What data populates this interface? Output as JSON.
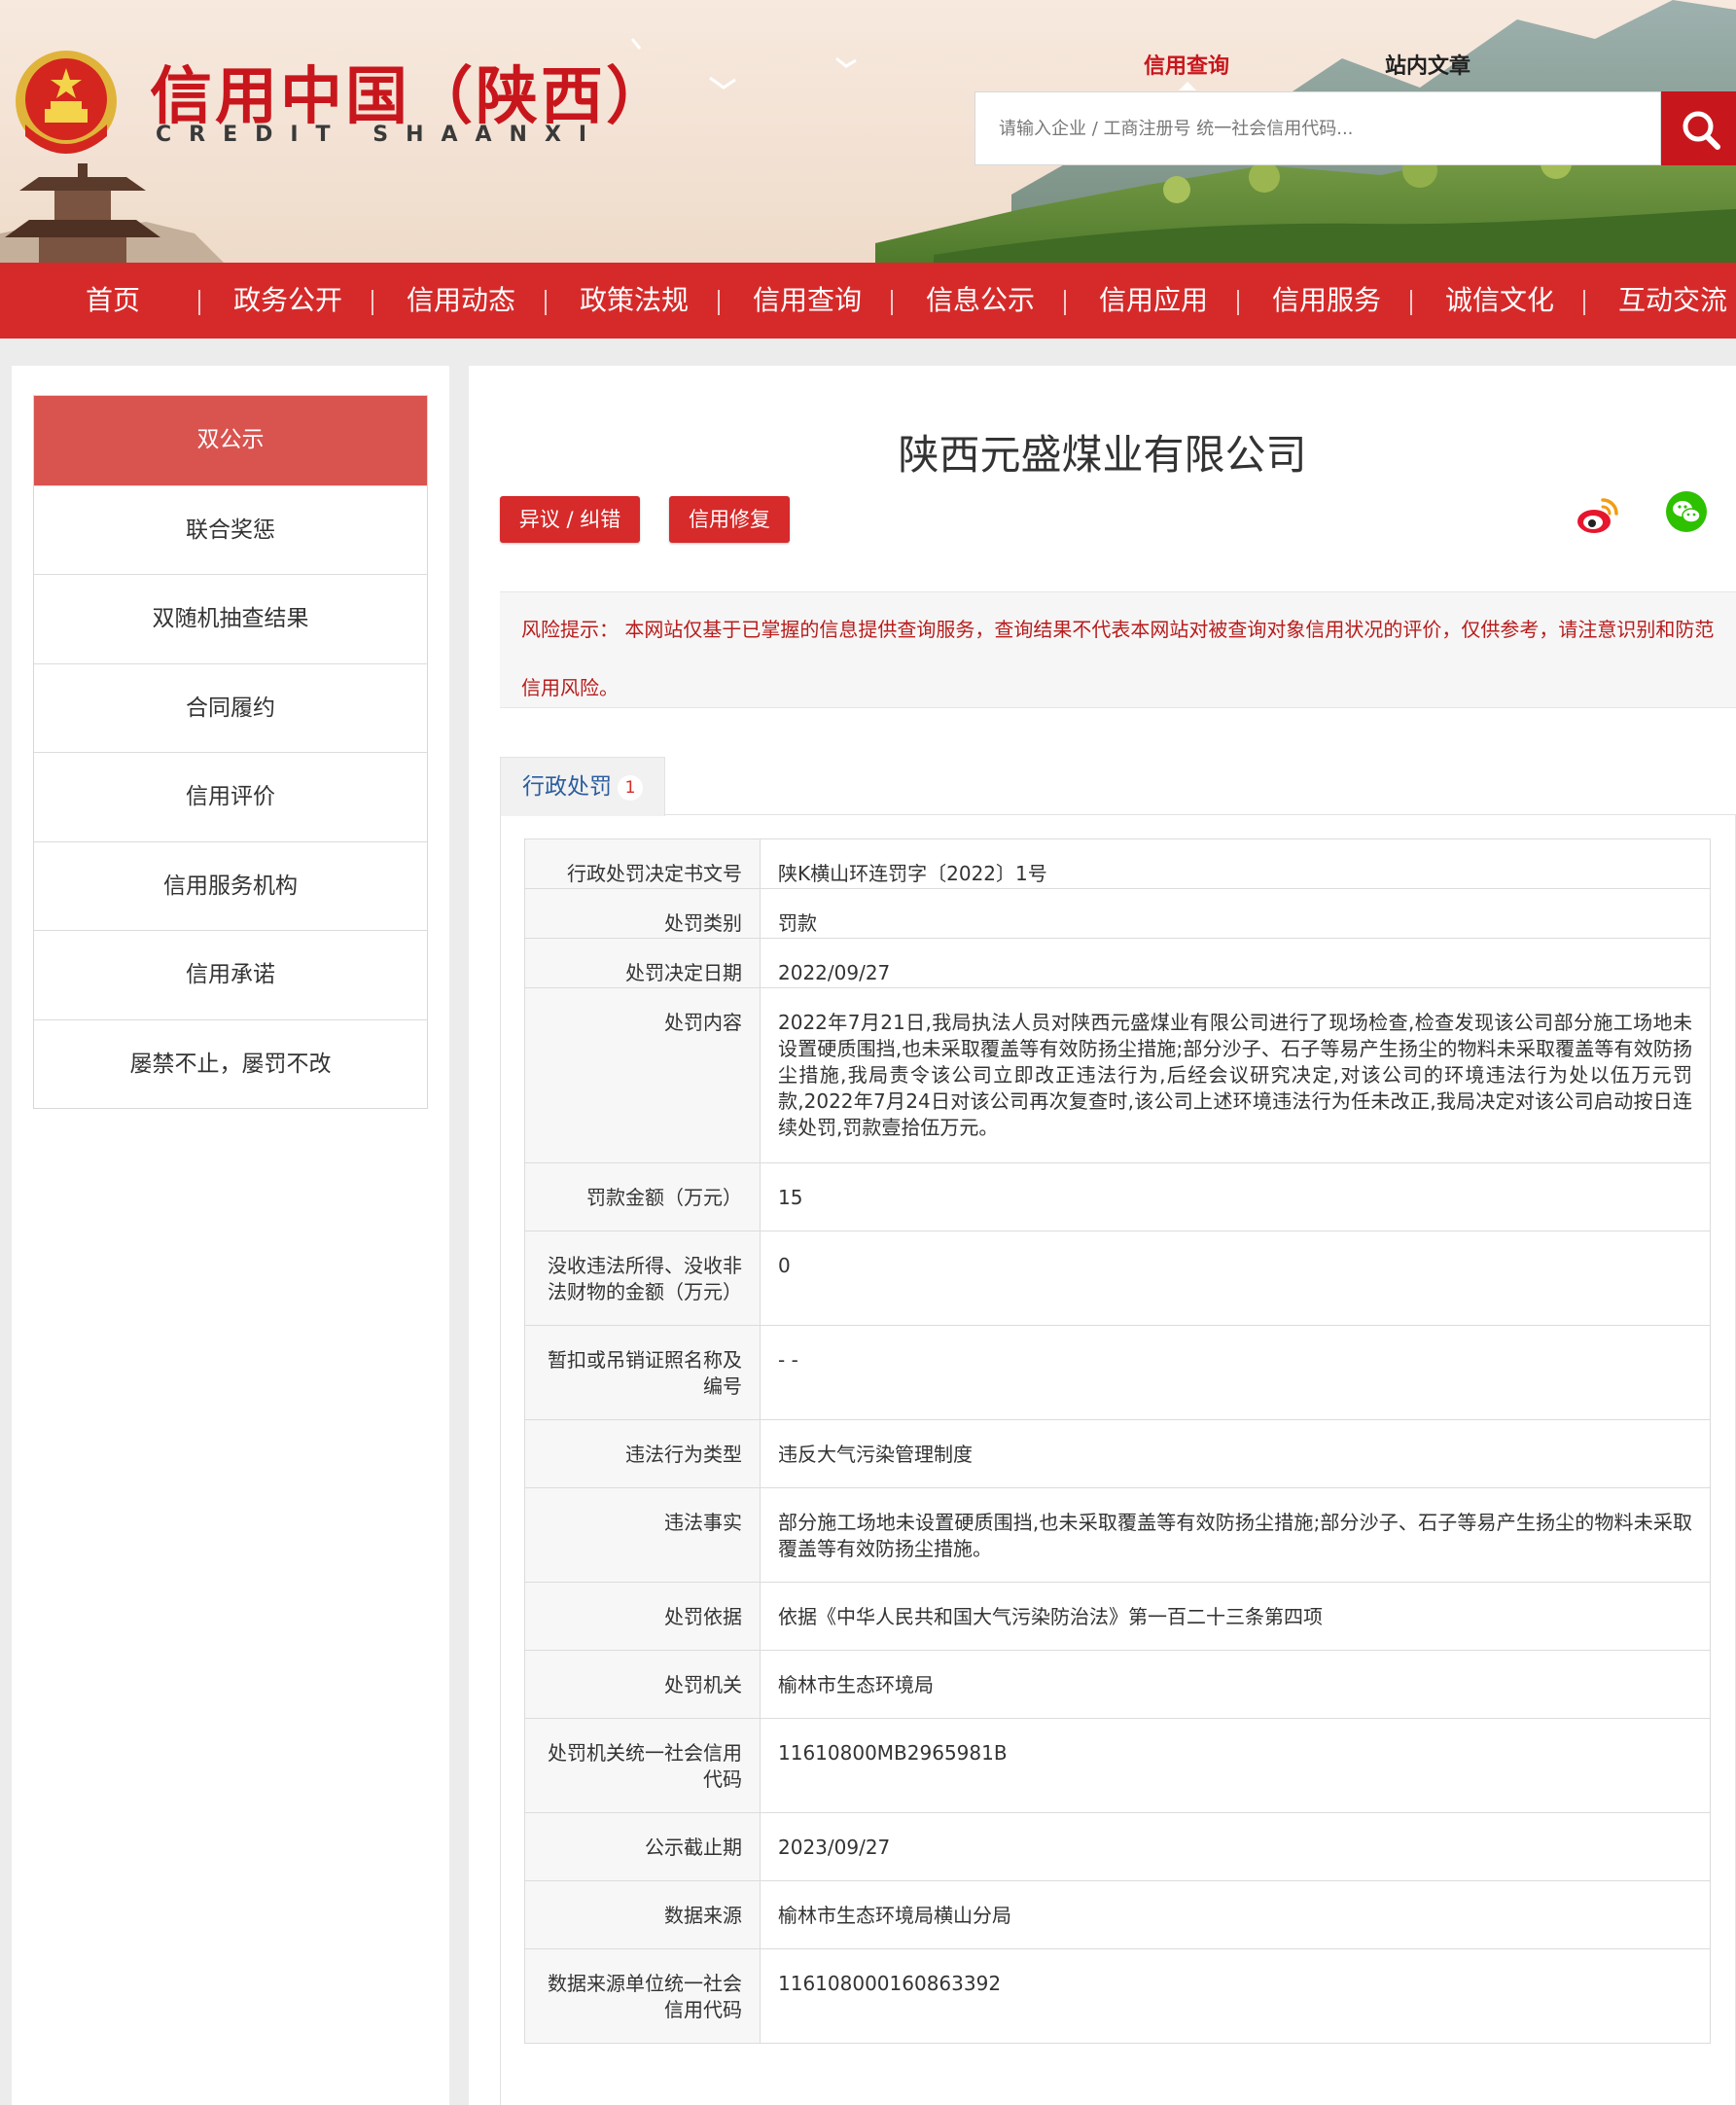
{
  "header": {
    "site_title": "信用中国（陕西）",
    "site_subtitle": "CREDIT   SHAANXI",
    "search_tabs": [
      {
        "label": "信用查询",
        "active": true
      },
      {
        "label": "站内文章",
        "active": false
      }
    ],
    "search_placeholder": "请输入企业 / 工商注册号 统一社会信用代码..."
  },
  "nav": {
    "items": [
      "首页",
      "政务公开",
      "信用动态",
      "政策法规",
      "信用查询",
      "信息公示",
      "信用应用",
      "信用服务",
      "诚信文化",
      "互动交流"
    ]
  },
  "sidebar": {
    "items": [
      {
        "label": "双公示",
        "active": true
      },
      {
        "label": "联合奖惩",
        "active": false
      },
      {
        "label": "双随机抽查结果",
        "active": false
      },
      {
        "label": "合同履约",
        "active": false
      },
      {
        "label": "信用评价",
        "active": false
      },
      {
        "label": "信用服务机构",
        "active": false
      },
      {
        "label": "信用承诺",
        "active": false
      },
      {
        "label": "屡禁不止，屡罚不改",
        "active": false
      }
    ]
  },
  "main": {
    "company_name": "陕西元盛煤业有限公司",
    "buttons": {
      "dispute": "异议 / 纠错",
      "repair": "信用修复"
    },
    "share_icons": [
      "weibo-icon",
      "wechat-icon"
    ],
    "risk_notice": "风险提示： 本网站仅基于已掌握的信息提供查询服务，查询结果不代表本网站对被查询对象信用状况的评价，仅供参考，请注意识别和防范信用风险。",
    "tab": {
      "label": "行政处罚",
      "count": "1"
    },
    "rows": [
      {
        "key": "行政处罚决定书文号",
        "value": "陕K横山环连罚字〔2022〕1号"
      },
      {
        "key": "处罚类别",
        "value": "罚款"
      },
      {
        "key": "处罚决定日期",
        "value": "2022/09/27"
      },
      {
        "key": "处罚内容",
        "value": "2022年7月21日,我局执法人员对陕西元盛煤业有限公司进行了现场检查,检查发现该公司部分施工场地未设置硬质围挡,也未采取覆盖等有效防扬尘措施;部分沙子、石子等易产生扬尘的物料未采取覆盖等有效防扬尘措施,我局责令该公司立即改正违法行为,后经会议研究决定,对该公司的环境违法行为处以伍万元罚款,2022年7月24日对该公司再次复查时,该公司上述环境违法行为任未改正,我局决定对该公司启动按日连续处罚,罚款壹拾伍万元。"
      },
      {
        "key": "罚款金额（万元）",
        "value": "15"
      },
      {
        "key": "没收违法所得、没收非法财物的金额（万元）",
        "value": "0"
      },
      {
        "key": "暂扣或吊销证照名称及编号",
        "value": "- -"
      },
      {
        "key": "违法行为类型",
        "value": "违反大气污染管理制度"
      },
      {
        "key": "违法事实",
        "value": "部分施工场地未设置硬质围挡,也未采取覆盖等有效防扬尘措施;部分沙子、石子等易产生扬尘的物料未采取覆盖等有效防扬尘措施。"
      },
      {
        "key": "处罚依据",
        "value": "依据《中华人民共和国大气污染防治法》第一百二十三条第四项"
      },
      {
        "key": "处罚机关",
        "value": "榆林市生态环境局"
      },
      {
        "key": "处罚机关统一社会信用代码",
        "value": "11610800MB2965981B"
      },
      {
        "key": "公示截止期",
        "value": "2023/09/27"
      },
      {
        "key": "数据来源",
        "value": "榆林市生态环境局横山分局"
      },
      {
        "key": "数据来源单位统一社会信用代码",
        "value": "116108000160863392"
      }
    ]
  },
  "colors": {
    "brand_red": "#d62a2a",
    "title_red": "#c8161d",
    "link_blue": "#2a5d9f"
  }
}
